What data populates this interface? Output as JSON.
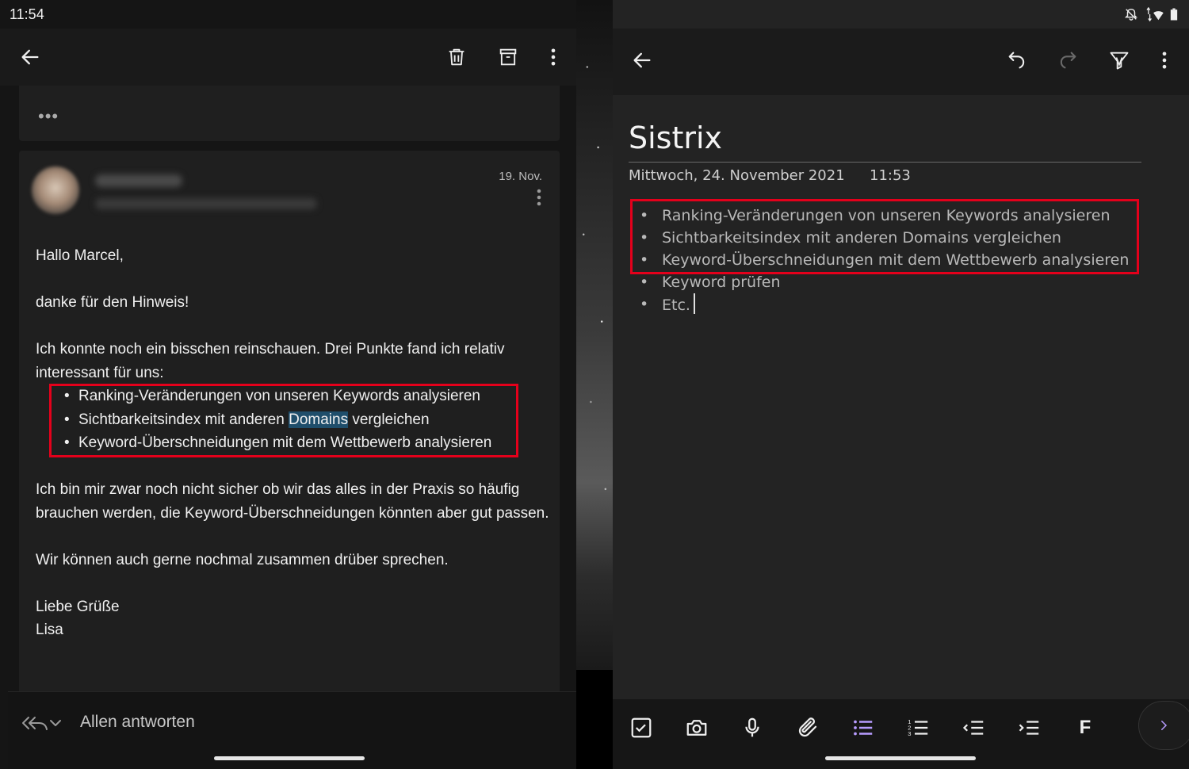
{
  "status_left": {
    "time": "11:54"
  },
  "mail": {
    "toolbar": {
      "back_icon": "arrow-left-icon",
      "delete_icon": "trash-icon",
      "archive_icon": "archive-icon",
      "more_icon": "more-vertical-icon"
    },
    "previous_message": {
      "ellipsis": "•••"
    },
    "message": {
      "date": "19. Nov.",
      "greeting": "Hallo Marcel,",
      "line1": "danke für den Hinweis!",
      "para1": "Ich konnte noch ein bisschen reinschauen. Drei Punkte fand ich relativ interessant für uns:",
      "bullets": [
        "Ranking-Veränderungen von unseren Keywords analysieren",
        {
          "before": "Sichtbarkeitsindex mit anderen ",
          "highlight": "Domains",
          "after": " vergleichen"
        },
        "Keyword-Überschneidungen mit dem Wettbewerb analysieren"
      ],
      "para2": "Ich bin mir zwar noch nicht sicher ob wir das alles in der Praxis so häufig brauchen werden, die Keyword-Überschneidungen könnten aber gut passen.",
      "para3": "Wir können auch gerne nochmal zusammen drüber sprechen.",
      "closing": "Liebe Grüße",
      "signature": "Lisa"
    },
    "reply": {
      "label": "Allen antworten",
      "icon": "reply-all-icon"
    }
  },
  "note": {
    "toolbar": {
      "back_icon": "arrow-left-icon",
      "undo_icon": "undo-icon",
      "redo_icon": "redo-icon",
      "highlighter_icon": "highlighter-icon",
      "more_icon": "more-vertical-icon"
    },
    "title": "Sistrix",
    "date": "Mittwoch, 24. November 2021",
    "time": "11:53",
    "items": [
      "Ranking-Veränderungen von unseren Keywords analysieren",
      "Sichtbarkeitsindex mit anderen Domains vergleichen",
      "Keyword-Überschneidungen mit dem Wettbewerb analysieren",
      "Keyword prüfen",
      "Etc."
    ],
    "format_toolbar": {
      "bold_label": "F",
      "icons": [
        "checkbox-icon",
        "camera-icon",
        "microphone-icon",
        "attachment-icon",
        "bulleted-list-icon",
        "numbered-list-icon",
        "outdent-icon",
        "indent-icon",
        "chevron-right-icon"
      ]
    }
  },
  "colors": {
    "highlight_box": "#e4001b",
    "text_selection": "#1f4e6b",
    "active_tool": "#b79cff"
  }
}
